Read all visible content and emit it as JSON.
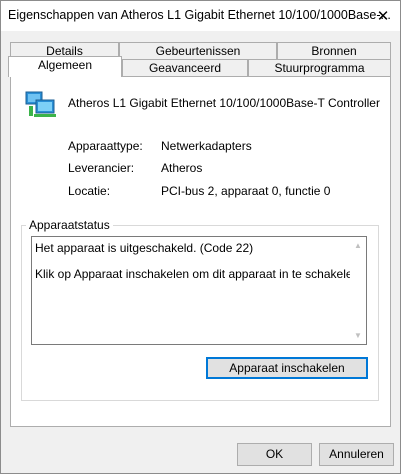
{
  "window": {
    "title": "Eigenschappen van Atheros L1 Gigabit Ethernet 10/100/1000Base-...",
    "close_glyph": "✕"
  },
  "tabs": {
    "row_top": [
      "Details",
      "Gebeurtenissen",
      "Bronnen"
    ],
    "row_bottom": [
      "Algemeen",
      "Geavanceerd",
      "Stuurprogramma"
    ],
    "selected": "Algemeen"
  },
  "device": {
    "icon": "network-adapter-icon",
    "name": "Atheros L1 Gigabit Ethernet 10/100/1000Base-T Controller"
  },
  "properties": [
    {
      "label": "Apparaattype:",
      "value": "Netwerkadapters"
    },
    {
      "label": "Leverancier:",
      "value": "Atheros"
    },
    {
      "label": "Locatie:",
      "value": "PCI-bus 2, apparaat 0, functie 0"
    }
  ],
  "status": {
    "legend": "Apparaatstatus",
    "lines": [
      "Het apparaat is uitgeschakeld. (Code 22)",
      "Klik op Apparaat inschakelen om dit apparaat in te schakelen."
    ],
    "enable_button": "Apparaat inschakelen"
  },
  "footer": {
    "ok_label": "OK",
    "cancel_label": "Annuleren"
  },
  "colors": {
    "accent": "#0078d7",
    "icon_blue": "#2a8fd6",
    "icon_green": "#3cb34a"
  }
}
